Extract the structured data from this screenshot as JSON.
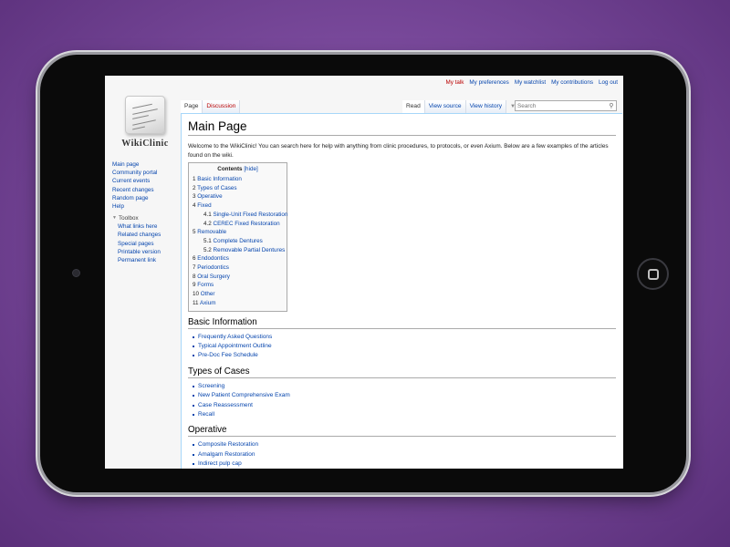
{
  "personal_tools": [
    {
      "label": "My talk",
      "color": "#ba0000"
    },
    {
      "label": "My preferences"
    },
    {
      "label": "My watchlist"
    },
    {
      "label": "My contributions"
    },
    {
      "label": "Log out"
    }
  ],
  "logo": {
    "text": "WikiClinic"
  },
  "sidebar": {
    "nav": [
      "Main page",
      "Community portal",
      "Current events",
      "Recent changes",
      "Random page",
      "Help"
    ],
    "toolbox_label": "Toolbox",
    "toolbox": [
      "What links here",
      "Related changes",
      "Special pages",
      "Printable version",
      "Permanent link"
    ]
  },
  "tabs": {
    "page": "Page",
    "discussion": "Discussion",
    "read": "Read",
    "view_source": "View source",
    "view_history": "View history",
    "more": "▼"
  },
  "search": {
    "placeholder": "Search"
  },
  "main": {
    "title": "Main Page",
    "intro": "Welcome to the WikiClinic! You can search here for help with anything from clinic procedures, to protocols, or even Axium. Below are a few examples of the articles found on the wiki.",
    "toc": {
      "title": "Contents",
      "hide": "[hide]",
      "items": [
        {
          "num": "1",
          "label": "Basic Information",
          "sub": false
        },
        {
          "num": "2",
          "label": "Types of Cases",
          "sub": false
        },
        {
          "num": "3",
          "label": "Operative",
          "sub": false
        },
        {
          "num": "4",
          "label": "Fixed",
          "sub": false
        },
        {
          "num": "4.1",
          "label": "Single-Unit Fixed Restoration",
          "sub": true
        },
        {
          "num": "4.2",
          "label": "CEREC Fixed Restoration",
          "sub": true
        },
        {
          "num": "5",
          "label": "Removable",
          "sub": false
        },
        {
          "num": "5.1",
          "label": "Complete Dentures",
          "sub": true
        },
        {
          "num": "5.2",
          "label": "Removable Partial Dentures",
          "sub": true
        },
        {
          "num": "6",
          "label": "Endodontics",
          "sub": false
        },
        {
          "num": "7",
          "label": "Periodontics",
          "sub": false
        },
        {
          "num": "8",
          "label": "Oral Surgery",
          "sub": false
        },
        {
          "num": "9",
          "label": "Forms",
          "sub": false
        },
        {
          "num": "10",
          "label": "Other",
          "sub": false
        },
        {
          "num": "11",
          "label": "Axium",
          "sub": false
        }
      ]
    },
    "sections": [
      {
        "heading": "Basic Information",
        "links": [
          "Frequently Asked Questions",
          "Typical Appointment Outline",
          "Pre-Doc Fee Schedule"
        ]
      },
      {
        "heading": "Types of Cases",
        "links": [
          "Screening",
          "New Patient Comprehensive Exam",
          "Case Reassessment",
          "Recall"
        ]
      },
      {
        "heading": "Operative",
        "links": [
          "Composite Restoration",
          "Amalgam Restoration",
          "Indirect pulp cap"
        ]
      }
    ]
  }
}
